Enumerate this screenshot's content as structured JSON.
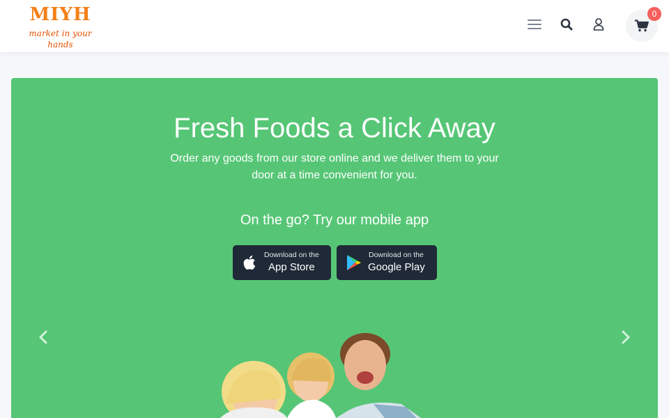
{
  "header": {
    "logo_main": "MIYH",
    "logo_tagline": "market in your hands",
    "cart_count": "0",
    "icons": [
      "menu-icon",
      "search-icon",
      "user-icon",
      "cart-icon"
    ]
  },
  "hero": {
    "title": "Fresh Foods a Click Away",
    "subtitle": "Order any goods from our store online and we deliver them to your door at a time convenient for you.",
    "app_heading": "On the go? Try our mobile app",
    "app_store": {
      "small": "Download on the",
      "big": "App Store"
    },
    "google_play": {
      "small": "Download on the",
      "big": "Google Play"
    },
    "icons": [
      "apple-icon",
      "google-play-icon",
      "chevron-left-icon",
      "chevron-right-icon"
    ]
  },
  "colors": {
    "brand_orange": "#f57f17",
    "hero_green": "#56c676",
    "badge_red": "#f5605c",
    "store_button": "#1f2937"
  }
}
